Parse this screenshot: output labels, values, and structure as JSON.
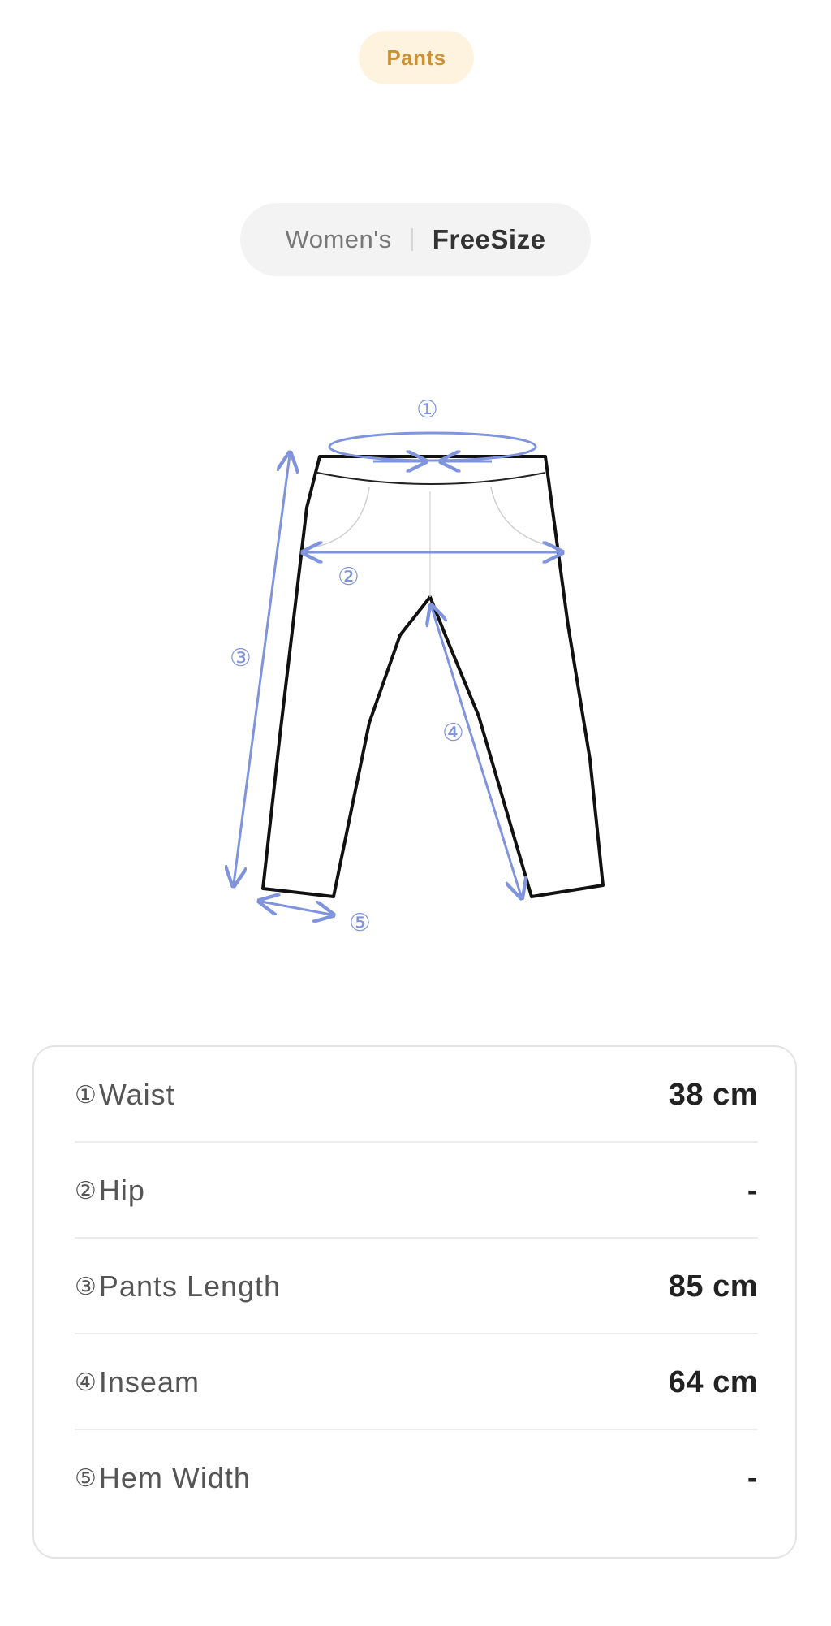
{
  "header": {
    "category": "Pants"
  },
  "size_selector": {
    "gender": "Women's",
    "size": "FreeSize"
  },
  "diagram": {
    "labels": [
      "①",
      "②",
      "③",
      "④",
      "⑤"
    ],
    "line_color": "#7f94dc",
    "outline_color": "#111111"
  },
  "measurements": [
    {
      "num": "①",
      "label": "Waist",
      "value": "38 cm"
    },
    {
      "num": "②",
      "label": "Hip",
      "value": "-"
    },
    {
      "num": "③",
      "label": "Pants Length",
      "value": "85 cm"
    },
    {
      "num": "④",
      "label": "Inseam",
      "value": "64 cm"
    },
    {
      "num": "⑤",
      "label": "Hem Width",
      "value": "-"
    }
  ],
  "colors": {
    "accent": "#c99237",
    "accent_bg": "#fdf3df",
    "toggle_bg": "#f3f3f3"
  }
}
